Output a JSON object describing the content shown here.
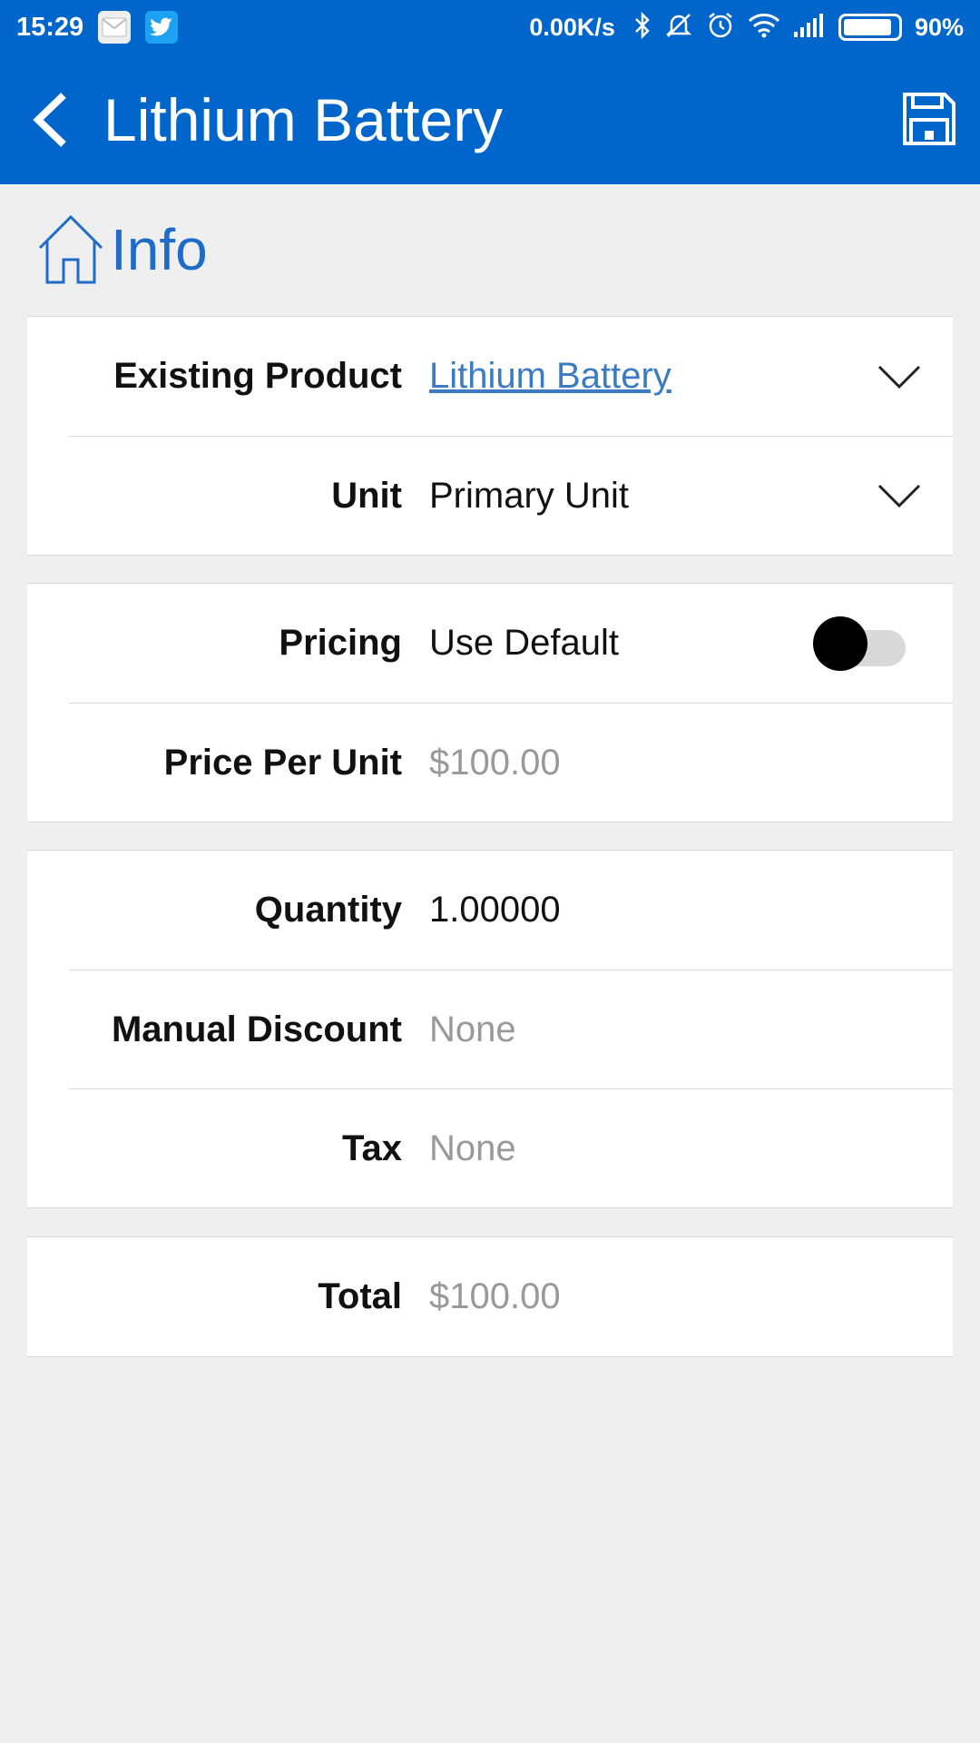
{
  "status_bar": {
    "time": "15:29",
    "net_speed": "0.00K/s",
    "battery_pct": "90%",
    "battery_level": 0.9,
    "icons": [
      "mail-icon",
      "twitter-icon",
      "bluetooth-icon",
      "mute-icon",
      "alarm-icon",
      "wifi-icon",
      "signal-icon",
      "battery-icon"
    ]
  },
  "header": {
    "title": "Lithium Battery",
    "back_icon": "chevron-left-icon",
    "save_icon": "save-icon"
  },
  "section": {
    "title": "Info",
    "icon": "home-icon"
  },
  "product": {
    "existing_product_label": "Existing Product",
    "existing_product_value": "Lithium Battery",
    "unit_label": "Unit",
    "unit_value": "Primary Unit"
  },
  "pricing": {
    "pricing_label": "Pricing",
    "pricing_value": "Use Default",
    "toggle_on": false,
    "price_per_unit_label": "Price Per Unit",
    "price_per_unit_value": "$100.00"
  },
  "quantity": {
    "quantity_label": "Quantity",
    "quantity_value": "1.00000",
    "discount_label": "Manual Discount",
    "discount_value": "None",
    "tax_label": "Tax",
    "tax_value": "None"
  },
  "total": {
    "total_label": "Total",
    "total_value": "$100.00"
  },
  "colors": {
    "brand_blue": "#0066cc",
    "link_blue": "#3a7bc3",
    "background": "#efefef"
  }
}
